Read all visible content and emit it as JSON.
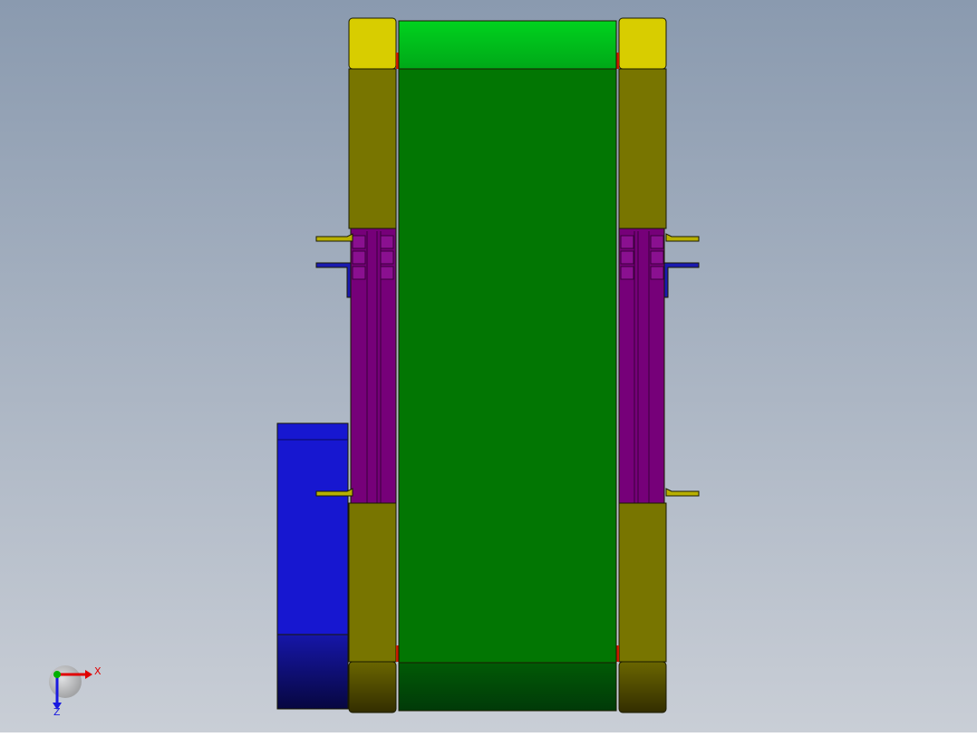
{
  "viewport": {
    "background_top": "#8a9aaf",
    "background_bottom": "#c9ced6"
  },
  "model": {
    "colors": {
      "belt_bright": "#00c81a",
      "belt": "#027603",
      "belt_dark": "#013d08",
      "side_plate": "#787500",
      "side_plate_dark": "#3e3800",
      "end_cap": "#d8cd00",
      "rail": "#760079",
      "motor": "#1717d0",
      "motor_dark": "#0a0a55",
      "bracket": "#1a1ab0",
      "accent_red": "#c81a00",
      "outline": "#1a1a00"
    }
  },
  "triad": {
    "x_label": "X",
    "z_label": "Z",
    "x_color": "#e00000",
    "y_color": "#00b000",
    "z_color": "#1a1ae0"
  }
}
